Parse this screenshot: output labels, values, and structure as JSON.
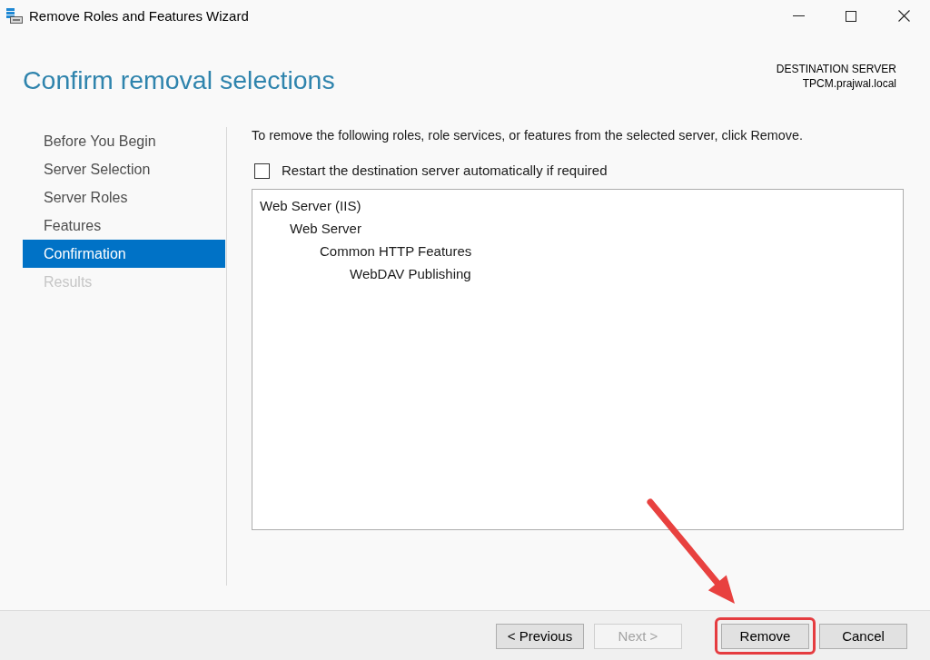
{
  "window": {
    "title": "Remove Roles and Features Wizard"
  },
  "header": {
    "title": "Confirm removal selections",
    "destination_label": "DESTINATION SERVER",
    "destination_server": "TPCM.prajwal.local"
  },
  "steps": [
    {
      "label": "Before You Begin",
      "selected": false,
      "disabled": false
    },
    {
      "label": "Server Selection",
      "selected": false,
      "disabled": false
    },
    {
      "label": "Server Roles",
      "selected": false,
      "disabled": false
    },
    {
      "label": "Features",
      "selected": false,
      "disabled": false
    },
    {
      "label": "Confirmation",
      "selected": true,
      "disabled": false
    },
    {
      "label": "Results",
      "selected": false,
      "disabled": true
    }
  ],
  "content": {
    "instruction": "To remove the following roles, role services, or features from the selected server, click Remove.",
    "restart_option": {
      "label": "Restart the destination server automatically if required",
      "checked": false
    },
    "selections": [
      {
        "label": "Web Server (IIS)",
        "children": [
          {
            "label": "Web Server",
            "children": [
              {
                "label": "Common HTTP Features",
                "children": [
                  {
                    "label": "WebDAV Publishing"
                  }
                ]
              }
            ]
          }
        ]
      }
    ]
  },
  "buttons": [
    {
      "label": "< Previous",
      "disabled": false,
      "highlighted": false
    },
    {
      "label": "Next >",
      "disabled": true,
      "highlighted": false
    },
    {
      "label": "Remove",
      "disabled": false,
      "highlighted": true
    },
    {
      "label": "Cancel",
      "disabled": false,
      "highlighted": false
    }
  ]
}
